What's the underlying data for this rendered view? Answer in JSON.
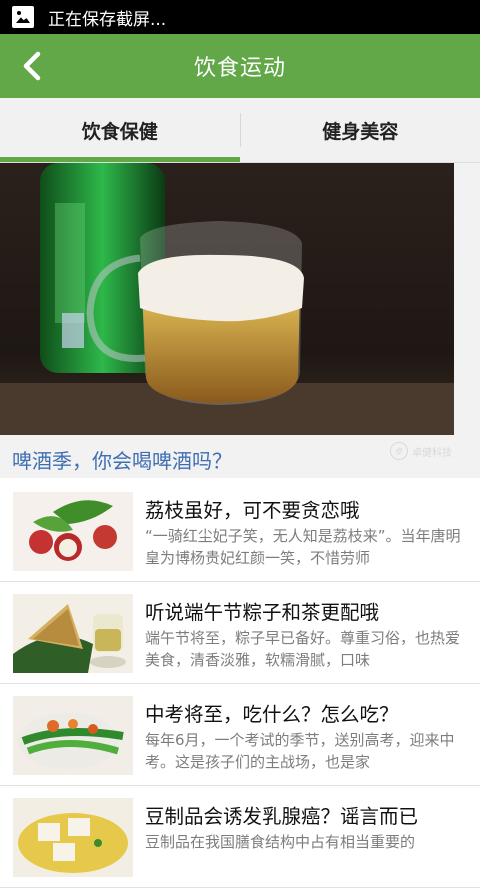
{
  "status_bar": {
    "text": "正在保存截屏...",
    "icon": "image-icon"
  },
  "app_bar": {
    "title": "饮食运动",
    "back_icon": "chevron-left-icon"
  },
  "tabs": [
    {
      "label": "饮食保健",
      "active": true
    },
    {
      "label": "健身美容",
      "active": false
    }
  ],
  "hero": {
    "caption": "啤酒季，你会喝啤酒吗？",
    "watermark": "卓健科技"
  },
  "articles": [
    {
      "title": "荔枝虽好，可不要贪恋哦",
      "desc": "“一骑红尘妃子笑，无人知是荔枝来”。当年唐明皇为博杨贵妃红颜一笑，不惜劳师"
    },
    {
      "title": "听说端午节粽子和茶更配哦",
      "desc": "端午节将至，粽子早已备好。尊重习俗，也热爱美食，清香淡雅，软糯滑腻，口味"
    },
    {
      "title": "中考将至，吃什么？怎么吃？",
      "desc": "每年6月，一个考试的季节，送别高考，迎来中考。这是孩子们的主战场，也是家"
    },
    {
      "title": "豆制品会诱发乳腺癌？谣言而已",
      "desc": "豆制品在我国膳食结构中占有相当重要的"
    }
  ],
  "colors": {
    "accent": "#62a848",
    "link": "#3f6fb2"
  }
}
